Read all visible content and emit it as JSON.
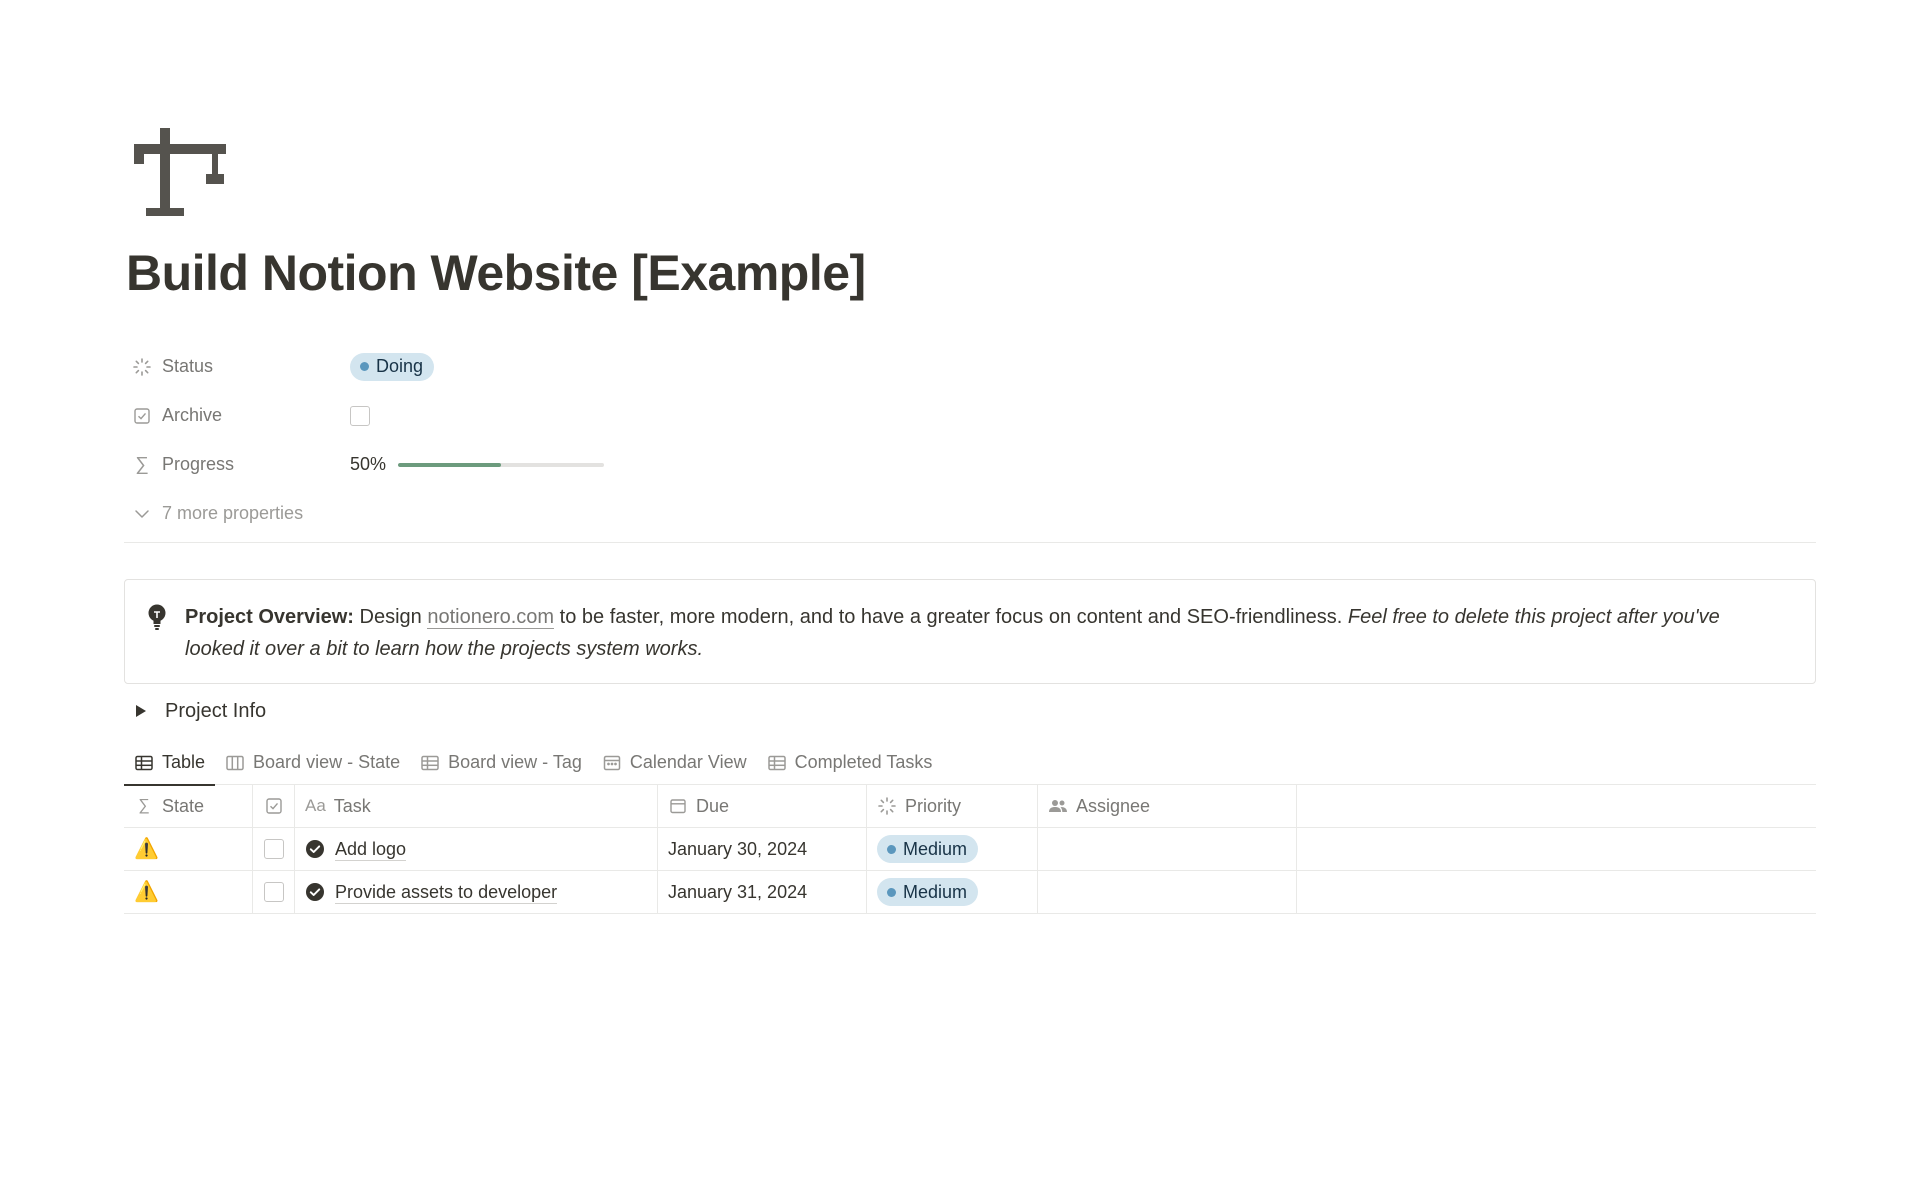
{
  "page": {
    "icon": "crane-icon",
    "title": "Build Notion Website [Example]"
  },
  "properties": {
    "status": {
      "label": "Status",
      "value": "Doing",
      "color": "#d3e5ef",
      "dot_color": "#5b97bd"
    },
    "archive": {
      "label": "Archive",
      "checked": false
    },
    "progress": {
      "label": "Progress",
      "text": "50%",
      "fraction": 0.5,
      "color": "#6c9b7d"
    },
    "more": {
      "label": "7 more properties"
    }
  },
  "callout": {
    "icon": "lightbulb-icon",
    "bold": "Project Overview:",
    "pre_link": " Design ",
    "link": "notionero.com",
    "post_link": " to be faster, more modern, and to have a greater focus on content and SEO-friendliness. ",
    "italic": "Feel free to delete this project after you've looked it over a bit to learn how the projects system works."
  },
  "toggle": {
    "label": "Project Info"
  },
  "tabs": [
    {
      "label": "Table",
      "icon": "table-icon",
      "active": true
    },
    {
      "label": "Board view - State",
      "icon": "board-icon",
      "active": false
    },
    {
      "label": "Board view - Tag",
      "icon": "table-icon",
      "active": false
    },
    {
      "label": "Calendar View",
      "icon": "calendar-icon",
      "active": false
    },
    {
      "label": "Completed Tasks",
      "icon": "table-icon",
      "active": false
    }
  ],
  "table": {
    "columns": {
      "state": "State",
      "task_prefix": "Aa",
      "task": "Task",
      "due": "Due",
      "priority": "Priority",
      "assignee": "Assignee"
    },
    "rows": [
      {
        "state": "⚠️",
        "done": false,
        "task": "Add logo",
        "due": "January 30, 2024",
        "priority": "Medium",
        "assignee": ""
      },
      {
        "state": "⚠️",
        "done": false,
        "task": "Provide assets to developer",
        "due": "January 31, 2024",
        "priority": "Medium",
        "assignee": ""
      }
    ]
  }
}
